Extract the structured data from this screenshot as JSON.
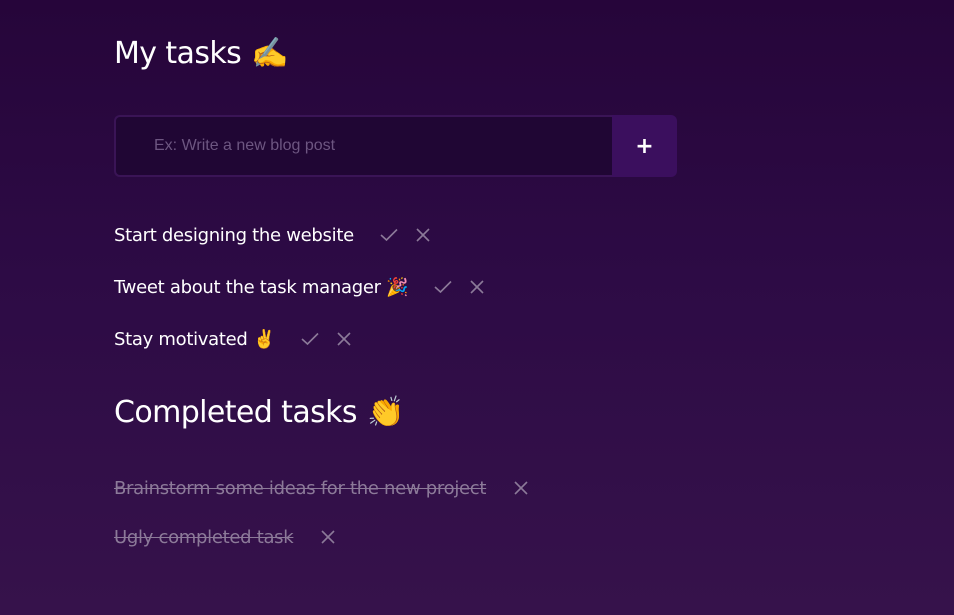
{
  "header": {
    "title": "My tasks",
    "title_emoji": "✍️"
  },
  "add_form": {
    "placeholder": "Ex: Write a new blog post",
    "add_label": "+"
  },
  "tasks": [
    {
      "text": "Start designing the website"
    },
    {
      "text": "Tweet about the task manager 🎉"
    },
    {
      "text": "Stay motivated ✌️"
    }
  ],
  "completed_header": {
    "title": "Completed tasks",
    "title_emoji": "👏"
  },
  "completed_tasks": [
    {
      "text": "Brainstorm some ideas for the new project"
    },
    {
      "text": "Ugly completed task"
    }
  ],
  "icons": {
    "complete": "check-icon",
    "remove": "close-icon"
  },
  "colors": {
    "background_top": "#26053a",
    "background_bottom": "#36124b",
    "input_bg": "#200634",
    "button_bg": "#3b0f5e",
    "icon_color": "#8c7a99",
    "completed_text": "#8c7a99"
  }
}
